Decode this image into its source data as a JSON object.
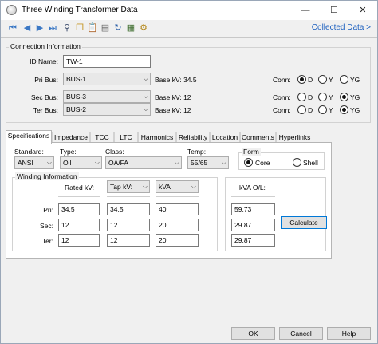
{
  "window": {
    "title": "Three Winding Transformer Data",
    "minimize": "—",
    "maximize": "☐",
    "close": "✕"
  },
  "toolbar": {
    "icons": [
      "first-record-icon",
      "prev-record-icon",
      "next-record-icon",
      "last-record-icon",
      "find-icon",
      "copy-icon",
      "paste-icon",
      "print-icon",
      "undo-icon",
      "apply-icon",
      "settings-icon"
    ],
    "collected_link": "Collected Data >"
  },
  "connection": {
    "group_title": "Connection Information",
    "id_label": "ID Name:",
    "id_value": "TW-1",
    "conn_label": "Conn:",
    "conn_options": [
      "D",
      "Y",
      "YG"
    ],
    "buses": [
      {
        "label": "Pri Bus:",
        "value": "BUS-1",
        "basekv": "Base kV: 34.5",
        "conn": "D"
      },
      {
        "label": "Sec Bus:",
        "value": "BUS-3",
        "basekv": "Base kV: 12",
        "conn": "YG"
      },
      {
        "label": "Ter Bus:",
        "value": "BUS-2",
        "basekv": "Base kV: 12",
        "conn": "YG"
      }
    ]
  },
  "tabs": [
    "Specifications",
    "Impedance",
    "TCC",
    "LTC",
    "Harmonics",
    "Reliability",
    "Location",
    "Comments",
    "Hyperlinks"
  ],
  "active_tab": "Specifications",
  "specs": {
    "standard_label": "Standard:",
    "standard_value": "ANSI",
    "type_label": "Type:",
    "type_value": "Oil",
    "class_label": "Class:",
    "class_value": "OA/FA",
    "temp_label": "Temp:",
    "temp_value": "55/65",
    "form_title": "Form",
    "form_options": [
      "Core",
      "Shell"
    ],
    "form_selected": "Core"
  },
  "winding": {
    "group_title": "Winding Information",
    "rated_kv_label": "Rated kV:",
    "tap_kv_label": "Tap kV:",
    "unit_value": "kVA",
    "rows": [
      {
        "label": "Pri:",
        "rated": "34.5",
        "tap": "34.5",
        "kva": "40"
      },
      {
        "label": "Sec:",
        "rated": "12",
        "tap": "12",
        "kva": "20"
      },
      {
        "label": "Ter:",
        "rated": "12",
        "tap": "12",
        "kva": "20"
      }
    ]
  },
  "overload": {
    "label": "kVA O/L:",
    "values": [
      "59.73",
      "29.87",
      "29.87"
    ],
    "calculate": "Calculate"
  },
  "footer": {
    "ok": "OK",
    "cancel": "Cancel",
    "help": "Help"
  },
  "colors": {
    "link": "#1b5fbf",
    "window_bg": "#f0f0f0",
    "focus_border": "#0078d7"
  }
}
